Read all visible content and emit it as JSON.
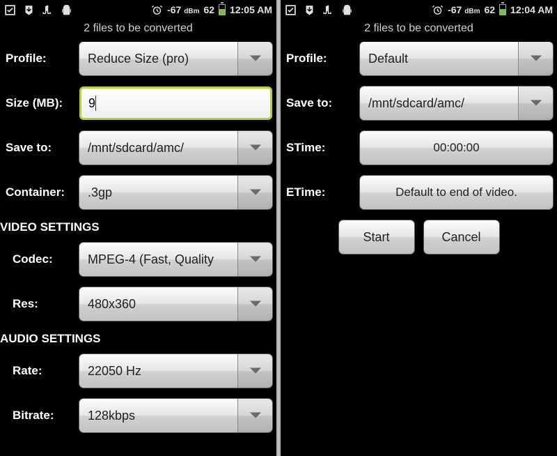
{
  "left": {
    "status": {
      "signal": "-67",
      "unit": "dBm",
      "battery": "62",
      "time": "12:05 AM"
    },
    "subheader": "2  files to be converted",
    "profile_label": "Profile:",
    "profile_value": "Reduce Size (pro)",
    "size_label": "Size (MB):",
    "size_value": "9",
    "saveto_label": "Save to:",
    "saveto_value": "/mnt/sdcard/amc/",
    "container_label": "Container:",
    "container_value": ".3gp",
    "video_header": "VIDEO SETTINGS",
    "codec_label": "Codec:",
    "codec_value": "MPEG-4 (Fast, Quality",
    "res_label": "Res:",
    "res_value": "480x360",
    "audio_header": "AUDIO SETTINGS",
    "rate_label": "Rate:",
    "rate_value": "22050 Hz",
    "bitrate_label": "Bitrate:",
    "bitrate_value": "128kbps"
  },
  "right": {
    "status": {
      "signal": "-67",
      "unit": "dBm",
      "battery": "62",
      "time": "12:04 AM"
    },
    "subheader": "2  files to be converted",
    "profile_label": "Profile:",
    "profile_value": "Default",
    "saveto_label": "Save to:",
    "saveto_value": "/mnt/sdcard/amc/",
    "stime_label": "STime:",
    "stime_value": "00:00:00",
    "etime_label": "ETime:",
    "etime_value": "Default to end of video.",
    "start_label": "Start",
    "cancel_label": "Cancel"
  }
}
